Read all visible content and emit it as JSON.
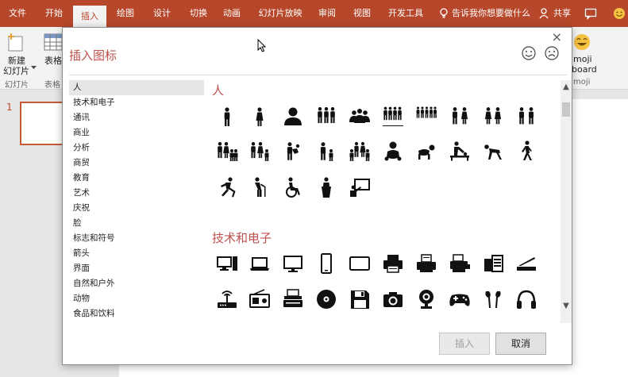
{
  "ribbon_tabs": [
    {
      "label": "文件",
      "active": false
    },
    {
      "label": "开始",
      "active": false
    },
    {
      "label": "插入",
      "active": true
    },
    {
      "label": "绘图",
      "active": false
    },
    {
      "label": "设计",
      "active": false
    },
    {
      "label": "切换",
      "active": false
    },
    {
      "label": "动画",
      "active": false
    },
    {
      "label": "幻灯片放映",
      "active": false
    },
    {
      "label": "审阅",
      "active": false
    },
    {
      "label": "视图",
      "active": false
    },
    {
      "label": "开发工具",
      "active": false
    }
  ],
  "tell_me": "告诉我你想要做什么",
  "share": "共享",
  "ribbon": {
    "new_slide_line1": "新建",
    "new_slide_line2": "幻灯片",
    "new_slide_group": "幻灯片",
    "table_label": "表格",
    "table_group": "表格",
    "emoji_line1": "moji",
    "emoji_line2": "board",
    "emoji_group": "moji"
  },
  "slide_panel": {
    "number": "1"
  },
  "dialog": {
    "title": "插入图标",
    "close": "×",
    "categories": [
      {
        "label": "人",
        "selected": true
      },
      {
        "label": "技术和电子",
        "selected": false
      },
      {
        "label": "通讯",
        "selected": false
      },
      {
        "label": "商业",
        "selected": false
      },
      {
        "label": "分析",
        "selected": false
      },
      {
        "label": "商贸",
        "selected": false
      },
      {
        "label": "教育",
        "selected": false
      },
      {
        "label": "艺术",
        "selected": false
      },
      {
        "label": "庆祝",
        "selected": false
      },
      {
        "label": "脸",
        "selected": false
      },
      {
        "label": "标志和符号",
        "selected": false
      },
      {
        "label": "箭头",
        "selected": false
      },
      {
        "label": "界面",
        "selected": false
      },
      {
        "label": "自然和户外",
        "selected": false
      },
      {
        "label": "动物",
        "selected": false
      },
      {
        "label": "食品和饮料",
        "selected": false
      }
    ],
    "sections": [
      {
        "title": "人",
        "icons": [
          "man-icon",
          "woman-icon",
          "person-bust-icon",
          "group-of-three-icon",
          "meeting-group-icon",
          "crowd-row-icon",
          "crowd-wide-icon",
          "couple-man-woman-icon",
          "couple-women-icon",
          "couple-men-icon",
          "family-four-icon",
          "family-parents-child-icon",
          "man-with-child-icon",
          "adult-with-child-icon",
          "family-group-icon",
          "baby-icon",
          "crawling-baby-icon",
          "person-changing-baby-icon",
          "person-crawling-icon",
          "person-walking-icon",
          "person-running-icon",
          "elderly-with-cane-icon",
          "wheelchair-icon",
          "speaker-at-podium-icon",
          "presenter-board-icon"
        ]
      },
      {
        "title": "技术和电子",
        "icons": [
          "desktop-computer-icon",
          "laptop-icon",
          "monitor-icon",
          "smartphone-icon",
          "tablet-icon",
          "printer-icon",
          "fax-printer-icon",
          "scanner-printer-icon",
          "server-rack-icon",
          "flatbed-scanner-icon",
          "wifi-router-icon",
          "radio-icon",
          "typewriter-icon",
          "disc-icon",
          "floppy-disk-icon",
          "camera-icon",
          "webcam-icon",
          "gamepad-icon",
          "earbuds-icon",
          "headphones-icon"
        ]
      }
    ],
    "insert_button": "插入",
    "cancel_button": "取消"
  },
  "colors": {
    "accent": "#b7472a",
    "title": "#c0504d"
  }
}
